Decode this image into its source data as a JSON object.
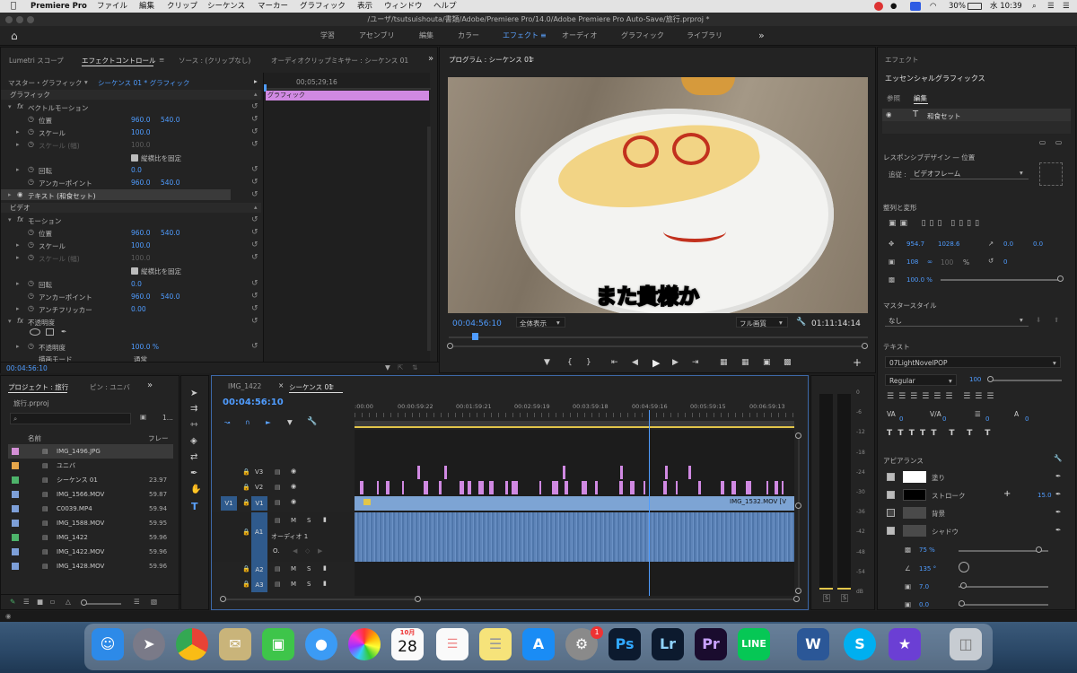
{
  "menubar": {
    "app": "Premiere Pro",
    "items": [
      "ファイル",
      "編集",
      "クリップ",
      "シーケンス",
      "マーカー",
      "グラフィック",
      "表示",
      "ウィンドウ",
      "ヘルプ"
    ],
    "battery": "30%",
    "clock": "水 10:39"
  },
  "titlebar": {
    "path": "/ユーザ/tsutsuishouta/書類/Adobe/Premiere Pro/14.0/Adobe Premiere Pro Auto-Save/旅行.prproj *"
  },
  "workspaces": {
    "items": [
      "学習",
      "アセンブリ",
      "編集",
      "カラー",
      "エフェクト",
      "オーディオ",
      "グラフィック",
      "ライブラリ"
    ],
    "active": "エフェクト",
    "more": "»"
  },
  "effect_controls": {
    "tabs": [
      "Lumetri スコープ",
      "エフェクトコントロール",
      "ソース : (クリップなし)",
      "オーディオクリップミキサー : シーケンス 01"
    ],
    "menu_icon": "≡",
    "master": "マスター・グラフィック",
    "seq": "シーケンス 01 * グラフィック",
    "ruler_time": "00;05;29;16",
    "clip_label": "グラフィック",
    "sections": {
      "graphic": "グラフィック",
      "video": "ビデオ"
    },
    "rows": {
      "vector_motion": "ベクトルモーション",
      "position": "位置",
      "position_x": "960.0",
      "position_y": "540.0",
      "scale": "スケール",
      "scale_val": "100.0",
      "scale_w": "スケール (幅)",
      "scale_w_val": "100.0",
      "lock_ratio": "縦横比を固定",
      "rotation": "回転",
      "rotation_val": "0.0",
      "anchor": "アンカーポイント",
      "anchor_x": "960.0",
      "anchor_y": "540.0",
      "text_layer": "テキスト (和食セット)",
      "motion": "モーション",
      "m_position": "位置",
      "m_position_x": "960.0",
      "m_position_y": "540.0",
      "m_scale": "スケール",
      "m_scale_val": "100.0",
      "m_scale_w": "スケール (幅)",
      "m_scale_w_val": "100.0",
      "m_lock_ratio": "縦横比を固定",
      "m_rotation": "回転",
      "m_rotation_val": "0.0",
      "m_anchor": "アンカーポイント",
      "m_anchor_x": "960.0",
      "m_anchor_y": "540.0",
      "antiflicker": "アンチフリッカー",
      "antiflicker_val": "0.00",
      "opacity_fx": "不透明度",
      "opacity": "不透明度",
      "opacity_val": "100.0 %",
      "blend": "描画モード",
      "blend_val": "通常"
    },
    "bottom_time": "00:04:56:10"
  },
  "program_monitor": {
    "title": "プログラム : シーケンス 01",
    "menu_icon": "≡",
    "subtitle": "また貴様か",
    "timecode": "00:04:56:10",
    "zoom": "全体表示",
    "quality": "フル画質",
    "duration": "01:11:14:14"
  },
  "project": {
    "tabs": [
      "プロジェクト : 旅行",
      "ピン : ユニバ"
    ],
    "more": "»",
    "file": "旅行.prproj",
    "count": "1...",
    "col_name": "名前",
    "col_frame": "フレー",
    "items": [
      {
        "name": "IMG_1496.JPG",
        "fps": "",
        "color": "#d48fd6",
        "sel": true
      },
      {
        "name": "ユニバ",
        "fps": "",
        "color": "#e6a64a",
        "sel": false
      },
      {
        "name": "シーケンス 01",
        "fps": "23.97",
        "color": "#4db36a",
        "sel": false
      },
      {
        "name": "IMG_1566.MOV",
        "fps": "59.87",
        "color": "#7d9fd8",
        "sel": false
      },
      {
        "name": "C0039.MP4",
        "fps": "59.94",
        "color": "#7d9fd8",
        "sel": false
      },
      {
        "name": "IMG_1588.MOV",
        "fps": "59.95",
        "color": "#7d9fd8",
        "sel": false
      },
      {
        "name": "IMG_1422",
        "fps": "59.96",
        "color": "#4db36a",
        "sel": false
      },
      {
        "name": "IMG_1422.MOV",
        "fps": "59.96",
        "color": "#7d9fd8",
        "sel": false
      },
      {
        "name": "IMG_1428.MOV",
        "fps": "59.96",
        "color": "#7d9fd8",
        "sel": false
      }
    ]
  },
  "timeline": {
    "tabs": [
      "IMG_1422",
      "シーケンス 01"
    ],
    "timecode": "00:04:56:10",
    "ruler": [
      ":00:00",
      "00:00:59:22",
      "00:01:59:21",
      "00:02:59:19",
      "00:03:59:18",
      "00:04:59:16",
      "00:05:59:15",
      "00:06:59:13"
    ],
    "tracks": {
      "v3": "V3",
      "v2": "V2",
      "v1": "V1",
      "a1": "A1",
      "a2": "A2",
      "a3": "A3",
      "src_v1": "V1"
    },
    "audio_label": "オーディオ 1",
    "clip_name": "IMG_1532.MOV [V",
    "mute": "M",
    "solo": "S",
    "playhead": 0.67
  },
  "audio_meter": {
    "ticks": [
      "0",
      "-6",
      "-12",
      "-18",
      "-24",
      "-30",
      "-36",
      "-42",
      "-48",
      "-54",
      "dB"
    ],
    "solo": "S"
  },
  "essential_graphics": {
    "panel_title": "エフェクト",
    "title": "エッセンシャルグラフィックス",
    "tabs": [
      "参照",
      "編集"
    ],
    "layer": "和食セット",
    "responsive": "レスポンシブデザイン — 位置",
    "follow_label": "追従 :",
    "follow_val": "ビデオフレーム",
    "align": "整列と変形",
    "pos_x": "954.7",
    "pos_y": "1028.6",
    "anchor_x": "0.0",
    "anchor_y": "0.0",
    "scale": "108",
    "scale2": "100",
    "scale_unit": "%",
    "rotation": "0",
    "opacity": "100.0 %",
    "master_style": "マスタースタイル",
    "master_style_val": "なし",
    "text": "テキスト",
    "font": "07LightNovelPOP",
    "weight": "Regular",
    "size": "100",
    "tracking_vals": [
      "0",
      "0",
      "0",
      "0"
    ],
    "appearance": "アピアランス",
    "fill": "塗り",
    "stroke": "ストローク",
    "stroke_val": "15.0",
    "bg": "背景",
    "shadow": "シャドウ",
    "shadow_vals": [
      "75 %",
      "135 °",
      "7.0",
      "0.0"
    ]
  },
  "dock": {
    "calendar_month": "10月",
    "calendar_day": "28",
    "badge": "1"
  }
}
